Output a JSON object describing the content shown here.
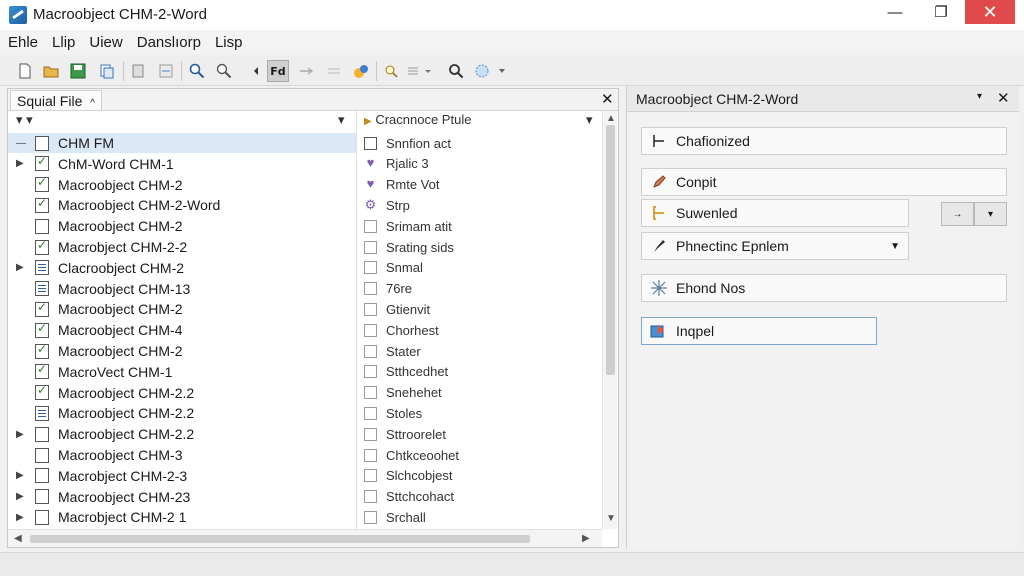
{
  "window": {
    "title": "Macroobject CHM-2-Word",
    "minimize": "—",
    "maximize": "❐",
    "close": "✕"
  },
  "menu": [
    "Ehle",
    "Llip",
    "Uiew",
    "Danslıorp",
    "Lisp"
  ],
  "toolbar": {
    "active_tool_label": "Fd",
    "icons": [
      "new-file-icon",
      "open-folder-icon",
      "save-icon",
      "copy-icon",
      "paste-icon",
      "format-icon",
      "zoom-in-icon",
      "zoom-out-icon",
      "brush-icon",
      "find-replace-icon",
      "arrow-icon",
      "color-icon",
      "search-doc-icon",
      "list-icon",
      "search-icon",
      "settings-icon"
    ]
  },
  "left_panel": {
    "tab_label": "Squial File",
    "tab_arrow": "^",
    "close": "✕",
    "column_left_arrows": "▾  ▾",
    "column_left_dropdown": "▾",
    "column_right_header": "Cracnnoce Ptule",
    "column_right_dropdown": "▾",
    "tree_items": [
      {
        "label": "CHM FM",
        "expander": "—",
        "selected": true
      },
      {
        "label": "ChM-Word CHM-1",
        "expander": "▶"
      },
      {
        "label": "Macroobject CHM-2",
        "expander": ""
      },
      {
        "label": "Macroobject CHM-2-Word",
        "expander": ""
      },
      {
        "label": "Macroobject CHM-2",
        "expander": ""
      },
      {
        "label": "Macrobject CHM-2-2",
        "expander": ""
      },
      {
        "label": "Clacroobject CHM-2",
        "expander": "▶"
      },
      {
        "label": "Macroobject CHM-13",
        "expander": ""
      },
      {
        "label": "Macroobject CHM-2",
        "expander": ""
      },
      {
        "label": "Macroobject CHM-4",
        "expander": ""
      },
      {
        "label": "Macroobject CHM-2",
        "expander": ""
      },
      {
        "label": "MacroVect CHM-1",
        "expander": ""
      },
      {
        "label": "Macroobject CHM-2.2",
        "expander": ""
      },
      {
        "label": "Macroobject CHM-2.2",
        "expander": ""
      },
      {
        "label": "Macroobject CHM-2.2",
        "expander": "▶"
      },
      {
        "label": "Macroobject CHM-3",
        "expander": ""
      },
      {
        "label": "Macrobject CHM-2-3",
        "expander": "▶"
      },
      {
        "label": "Macroobject CHM-23",
        "expander": "▶"
      },
      {
        "label": "Macrobject CHM-2 1",
        "expander": "▶"
      }
    ],
    "prop_items": [
      {
        "label": "Snnfion act",
        "mark": ""
      },
      {
        "label": "Rjalic 3",
        "mark": "♥"
      },
      {
        "label": "Rmte Vot",
        "mark": "♥"
      },
      {
        "label": "Strp",
        "mark": "⚙"
      },
      {
        "label": "Srimam atit",
        "mark": ""
      },
      {
        "label": "Srating sids",
        "mark": ""
      },
      {
        "label": "Snmal",
        "mark": ""
      },
      {
        "label": "76re",
        "mark": ""
      },
      {
        "label": "Gtienvit",
        "mark": ""
      },
      {
        "label": "Chorhest",
        "mark": ""
      },
      {
        "label": "Stater",
        "mark": ""
      },
      {
        "label": "Stthcedhet",
        "mark": ""
      },
      {
        "label": "Snehehet",
        "mark": ""
      },
      {
        "label": "Stoles",
        "mark": ""
      },
      {
        "label": "Sttroorelet",
        "mark": ""
      },
      {
        "label": "Chtkceoohet",
        "mark": ""
      },
      {
        "label": "Slchcobjest",
        "mark": ""
      },
      {
        "label": "Sttchcohact",
        "mark": ""
      },
      {
        "label": "Srchall",
        "mark": ""
      }
    ]
  },
  "right_panel": {
    "title": "Macroobject CHM-2-Word",
    "pin": "▾",
    "close": "✕",
    "buttons": [
      {
        "label": "Chafionized",
        "icon": "text-cursor-icon"
      },
      {
        "label": "Conpit",
        "icon": "pen-icon"
      },
      {
        "label": "Suwenled",
        "icon": "bracket-icon"
      },
      {
        "label": "Phnectinc Epnlem",
        "icon": "brush-icon",
        "dropdown": "▼"
      },
      {
        "label": "Ehond Nos",
        "icon": "sparkle-icon"
      },
      {
        "label": "Inqpel",
        "icon": "import-icon"
      }
    ],
    "small_buttons": [
      "→",
      "▾"
    ]
  }
}
